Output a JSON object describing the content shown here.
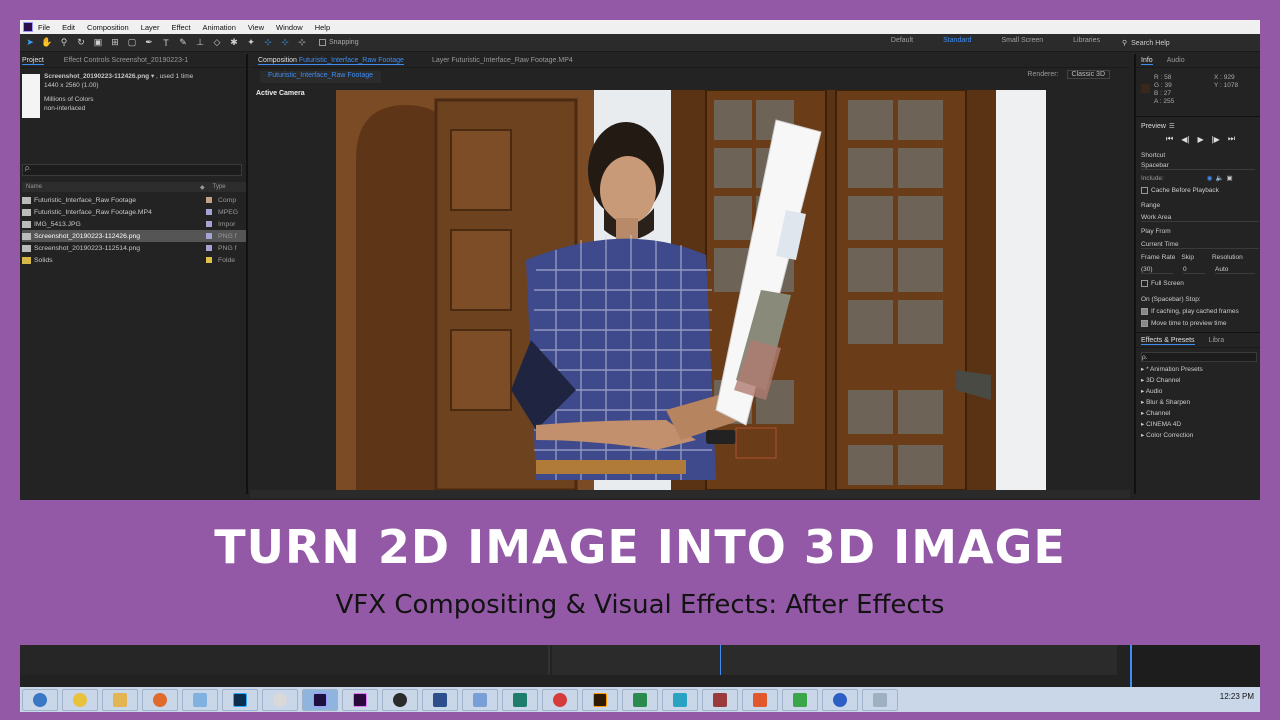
{
  "menu": [
    "File",
    "Edit",
    "Composition",
    "Layer",
    "Effect",
    "Animation",
    "View",
    "Window",
    "Help"
  ],
  "toolbar": {
    "snapping_label": "Snapping",
    "workspaces": [
      "Default",
      "Standard",
      "Small Screen",
      "Libraries"
    ],
    "active_workspace": "Standard",
    "search_placeholder": "Search Help"
  },
  "project": {
    "tabs": [
      "Project",
      "Effect Controls Screenshot_20190223-1"
    ],
    "selected_name": "Screenshot_20190223-112426.png",
    "used": ", used 1 time",
    "dimensions": "1440 x 2560 (1.00)",
    "colors": "Millions of Colors",
    "interlace": "non-interlaced",
    "search_placeholder": "ρ.",
    "col_name": "Name",
    "col_type": "Type",
    "items": [
      {
        "name": "Futuristic_Interface_Raw Footage",
        "type": "Comp",
        "color": "#c2a27f"
      },
      {
        "name": "Futuristic_Interface_Raw Footage.MP4",
        "type": "MPEG",
        "color": "#a3a3d6"
      },
      {
        "name": "IMG_5413.JPG",
        "type": "Impor",
        "color": "#a3a3d6"
      },
      {
        "name": "Screenshot_20190223-112426.png",
        "type": "PNG f",
        "color": "#a3a3d6"
      },
      {
        "name": "Screenshot_20190223-112514.png",
        "type": "PNG f",
        "color": "#a3a3d6"
      },
      {
        "name": "Solids",
        "type": "Folde",
        "color": "#e0c24a"
      }
    ]
  },
  "composition": {
    "tab_prefix": "Composition",
    "tab_name": "Futuristic_Interface_Raw Footage",
    "layer_tab": "Layer Futuristic_Interface_Raw Footage.MP4",
    "sub_tab": "Futuristic_Interface_Raw Footage",
    "renderer_label": "Renderer:",
    "renderer_value": "Classic 3D",
    "view_label": "Active Camera"
  },
  "info_panel": {
    "tabs": [
      "Info",
      "Audio"
    ],
    "r": "R : 58",
    "g": "G : 39",
    "b": "B : 27",
    "a": "A : 255",
    "x": "X : 929",
    "y": "Y : 1078"
  },
  "preview_panel": {
    "title": "Preview",
    "shortcut_label": "Shortcut",
    "shortcut_value": "Spacebar",
    "include_label": "Include:",
    "cache_label": "Cache Before Playback",
    "range_label": "Range",
    "range_value": "Work Area",
    "playfrom_label": "Play From",
    "playfrom_value": "Current Time",
    "framerate_label": "Frame Rate",
    "skip_label": "Skip",
    "resolution_label": "Resolution",
    "framerate_value": "(30)",
    "skip_value": "0",
    "resolution_value": "Auto",
    "fullscreen_label": "Full Screen",
    "stop_label": "On (Spacebar) Stop:",
    "stop_opt1": "If caching, play cached frames",
    "stop_opt2": "Move time to preview time"
  },
  "effects_panel": {
    "tabs": [
      "Effects & Presets",
      "Libra"
    ],
    "search_placeholder": "ρ.",
    "items": [
      "* Animation Presets",
      "3D Channel",
      "Audio",
      "Blur & Sharpen",
      "Channel",
      "CINEMA 4D",
      "Color Correction"
    ]
  },
  "headline": "TURN 2D IMAGE INTO 3D IMAGE",
  "subheadline": "VFX Compositing & Visual Effects: After Effects",
  "clock": "12:23 PM",
  "colors": {
    "background": "#9359a6",
    "accent": "#3d8df5"
  },
  "taskbar_icons": [
    "windows-start-icon",
    "chrome-icon",
    "folder-icon",
    "firefox-icon",
    "notepad-icon",
    "photoshop-icon",
    "media-icon",
    "after-effects-icon",
    "premiere-icon",
    "obs-icon",
    "app-icon",
    "word-icon",
    "arrow-icon",
    "app-red-icon",
    "illustrator-icon",
    "excel-icon",
    "vlc-icon",
    "edit-icon",
    "rar-icon",
    "app-green-icon",
    "app-blue-icon",
    "network-icon"
  ]
}
